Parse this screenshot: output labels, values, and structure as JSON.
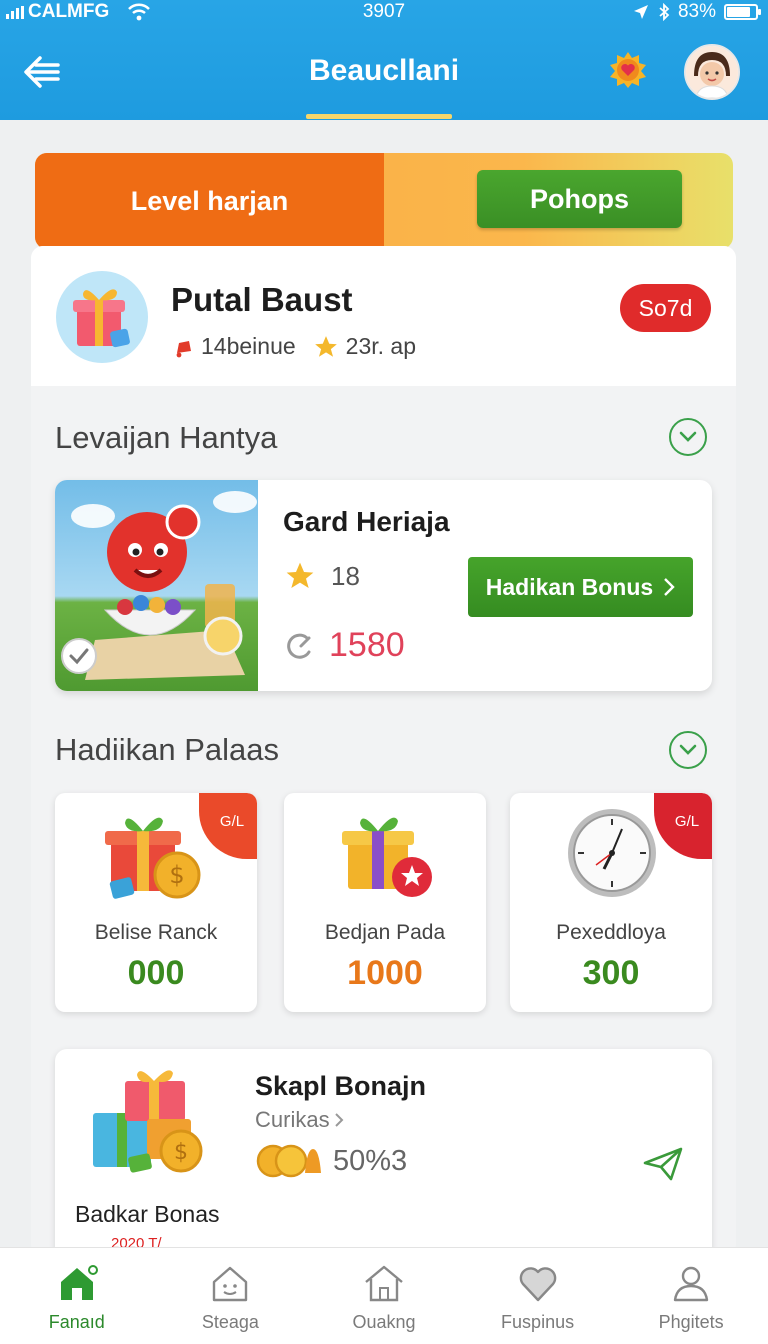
{
  "status_bar": {
    "carrier": "CALMFG",
    "time": "3907",
    "battery": "83%",
    "battery_level": 0.83
  },
  "header": {
    "title": "Beaucllani"
  },
  "level_banner": {
    "label": "Level harjan",
    "button": "Pohops"
  },
  "profile": {
    "name": "Putal Baust",
    "stat1": "14beinue",
    "stat2": "23r. ap",
    "badge": "So7d"
  },
  "section1": {
    "title": "Levaijan Hantya"
  },
  "featured": {
    "title": "Gard Heriaja",
    "stars": "18",
    "points": "1580",
    "button": "Hadikan Bonus"
  },
  "section2": {
    "title": "Hadiikan Palaas"
  },
  "products": [
    {
      "name": "Belise Ranck",
      "value": "000",
      "value_color": "#3a8a1f",
      "corner": "G/L",
      "corner_color": "#ea4a2a"
    },
    {
      "name": "Bedjan Pada",
      "value": "1000",
      "value_color": "#e8781a",
      "corner": "",
      "corner_color": ""
    },
    {
      "name": "Pexeddloya",
      "value": "300",
      "value_color": "#3a8a1f",
      "corner": "G/L",
      "corner_color": "#d8232e"
    }
  ],
  "bonus": {
    "title": "Skapl Bonajn",
    "subtitle": "Curikas",
    "percent": "50%3",
    "label": "Badkar Bonas",
    "small": "2020 T/"
  },
  "nav": [
    {
      "label": "Fanaıd",
      "icon": "home-icon",
      "active": true
    },
    {
      "label": "Steaga",
      "icon": "house-face-icon",
      "active": false
    },
    {
      "label": "Ouakng",
      "icon": "house-icon",
      "active": false
    },
    {
      "label": "Fuspinus",
      "icon": "heart-icon",
      "active": false
    },
    {
      "label": "Phgitets",
      "icon": "profile-icon",
      "active": false
    }
  ],
  "colors": {
    "header_blue": "#1e9bdf",
    "accent_green": "#3a8f25",
    "accent_orange": "#ef6c14",
    "badge_red": "#e02b2b"
  }
}
